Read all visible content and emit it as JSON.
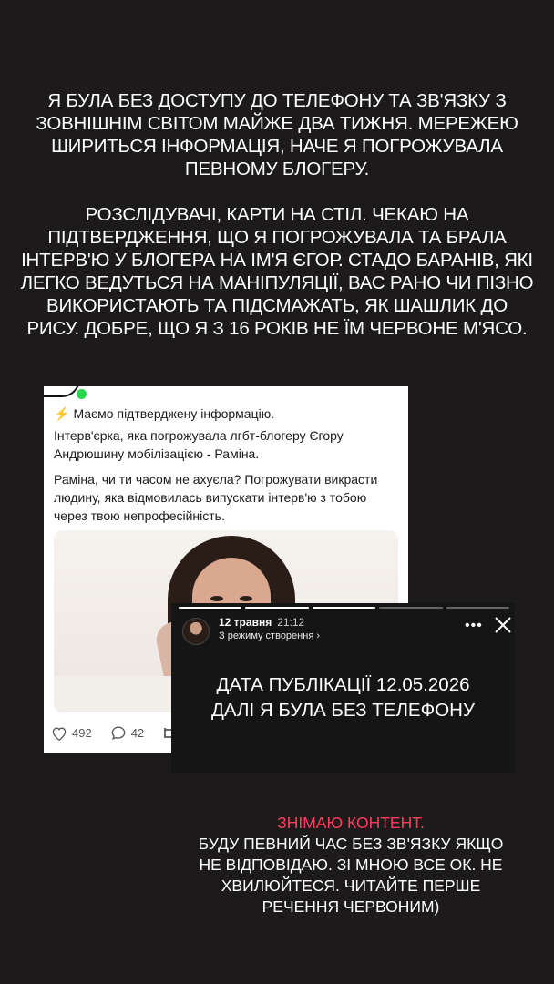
{
  "top_text": {
    "paragraph1": "Я БУЛА БЕЗ ДОСТУПУ ДО ТЕЛЕФОНУ ТА ЗВ'ЯЗКУ З ЗОВНІШНІМ СВІТОМ МАЙЖЕ ДВА ТИЖНЯ. МЕРЕЖЕЮ ШИРИТЬСЯ ІНФОРМАЦІЯ, НАЧЕ Я ПОГРОЖУВАЛА ПЕВНОМУ БЛОГЕРУ.",
    "paragraph2": "РОЗСЛІДУВАЧІ, КАРТИ НА СТІЛ. ЧЕКАЮ НА ПІДТВЕРДЖЕННЯ, ЩО Я ПОГРОЖУВАЛА ТА БРАЛА ІНТЕРВ'Ю У БЛОГЕРА НА ІМ'Я ЄГОР. СТАДО БАРАНІВ, ЯКІ ЛЕГКО ВЕДУТЬСЯ НА МАНІПУЛЯЦІЇ, ВАС РАНО ЧИ ПІЗНО ВИКОРИСТАЮТЬ ТА ПІДСМАЖАТЬ, ЯК ШАШЛИК ДО РИСУ. ДОБРЕ, ЩО Я З 16 РОКІВ НЕ ЇМ ЧЕРВОНЕ М'ЯСО."
  },
  "post": {
    "line1": "Маємо підтверджену інформацію.",
    "line2": "Інтерв'єрка, яка погрожувала лгбт-блогеру Єгору Андрюшину мобілізацією - Раміна.",
    "line3": "Раміна, чи ти часом не ахуєла? Погрожувати викрасти людину, яка відмовилась випускати інтерв'ю з тобою через твою непрофесійність.",
    "likes": "492",
    "comments": "42",
    "icons": [
      "lightning-icon",
      "heart-icon",
      "comment-icon",
      "repost-icon"
    ]
  },
  "story": {
    "date": "12 травня",
    "time": "21:12",
    "mode": "З режиму створення ›",
    "text_line1": "ДАТА ПУБЛІКАЦІЇ 12.05.2026",
    "text_line2": "ДАЛІ Я БУЛА БЕЗ ТЕЛЕФОНУ",
    "more": "•••"
  },
  "bottom_text": {
    "red_line": "ЗНІМАЮ КОНТЕНТ.",
    "rest": "БУДУ ПЕВНИЙ ЧАС БЕЗ ЗВ'ЯЗКУ ЯКЩО НЕ ВІДПОВІДАЮ. ЗІ МНОЮ ВСЕ ОК. НЕ ХВИЛЮЙТЕСЯ. ЧИТАЙТЕ ПЕРШЕ РЕЧЕННЯ ЧЕРВОНИМ)"
  },
  "colors": {
    "background": "#1c1a1b",
    "accent_red": "#ff3d5e",
    "online_dot": "#2bd74a"
  }
}
